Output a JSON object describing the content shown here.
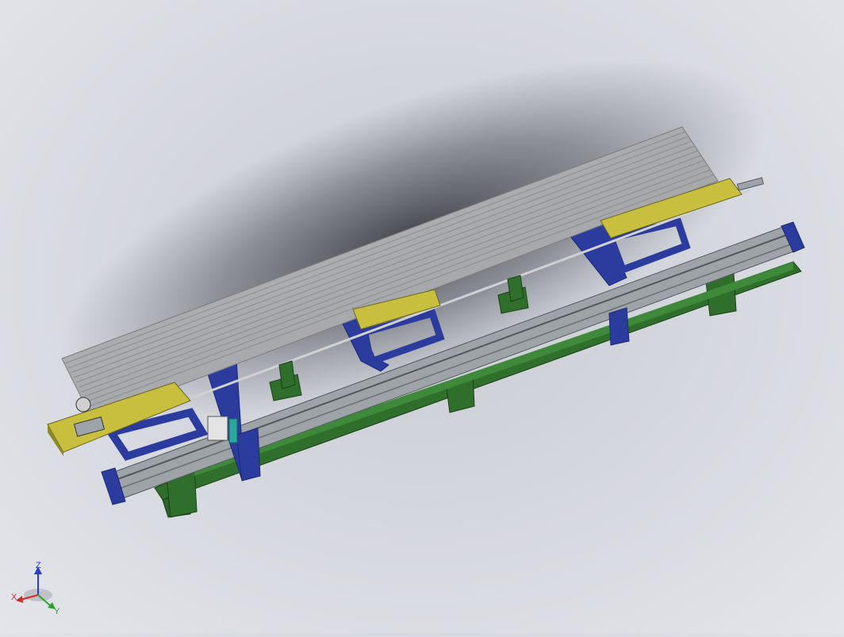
{
  "viewport": {
    "background_center": "#c3c6cd",
    "background_edge": "#e4e6eb",
    "shadow_color": "#2a2d33"
  },
  "model": {
    "colors": {
      "roller_table": "#a9abad",
      "roller_line": "#8c8e91",
      "yellow_parts": "#c9bf3f",
      "yellow_dark": "#8f8828",
      "blue_frame": "#2b3c9e",
      "blue_dark": "#1c2877",
      "green_base": "#2f6f2b",
      "green_dark": "#204d1d",
      "rail_gray": "#9ea3a8",
      "rail_dark": "#53585e",
      "teal_part": "#2aa7a0",
      "white_part": "#e4e4e4"
    }
  },
  "triad": {
    "x_label": "X",
    "y_label": "Y",
    "z_label": "Z",
    "x_color": "#d42a2a",
    "y_color": "#2aa32a",
    "z_color": "#2a3ad4"
  }
}
